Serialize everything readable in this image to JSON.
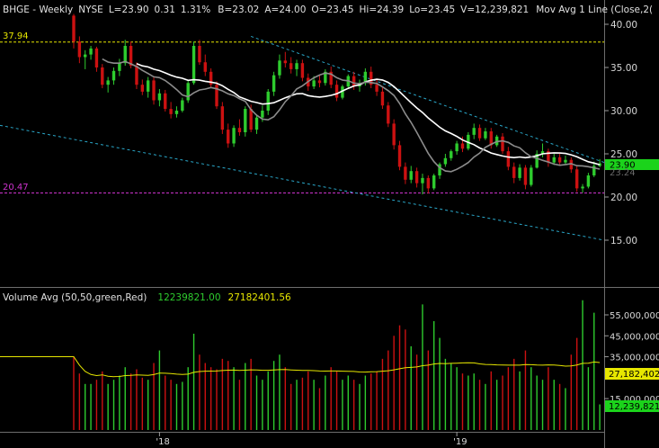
{
  "header": {
    "symbol": "BHGE - Weekly",
    "exchange": "NYSE",
    "last": "L=23.90",
    "change": "0.31",
    "change_pct": "1.31%",
    "bid": "B=23.02",
    "ask": "A=24.00",
    "open": "O=23.45",
    "high": "Hi=24.39",
    "low": "Lo=23.45",
    "volume": "V=12,239,821",
    "indicator": "Mov Avg 1 Line (Close,2("
  },
  "volume_header": {
    "label": "Volume Avg (50,50,green,Red)",
    "value1": "12239821.00",
    "value2": "27182401.56"
  },
  "price_axis": {
    "ticks": [
      {
        "value": 40,
        "label": "40.00"
      },
      {
        "value": 35,
        "label": "35.00"
      },
      {
        "value": 30,
        "label": "30.00"
      },
      {
        "value": 25,
        "label": "25.00"
      },
      {
        "value": 20,
        "label": "20.00"
      },
      {
        "value": 15,
        "label": "15.00"
      }
    ],
    "last_price_label": "23.90",
    "hidden_label": "23.24"
  },
  "volume_axis": {
    "ticks": [
      {
        "value": 55000000,
        "label": "55,000,000"
      },
      {
        "value": 45000000,
        "label": "45,000,000"
      },
      {
        "value": 35000000,
        "label": "35,000,000"
      },
      {
        "value": 15000000,
        "label": "15,000,000"
      }
    ],
    "avg_label": "27,182,402",
    "last_label": "12,239,821"
  },
  "levels": {
    "upper": {
      "value": 37.94,
      "label": "37.94"
    },
    "lower": {
      "value": 20.47,
      "label": "20.47"
    }
  },
  "x_axis": {
    "labels": [
      {
        "week": 15,
        "label": "'18"
      },
      {
        "week": 67,
        "label": "'19"
      }
    ]
  },
  "colors": {
    "up": "#2ecc2e",
    "down": "#cc1111",
    "upper_level": "#e6e600",
    "lower_level": "#cc33cc",
    "channel": "#2aa7c9",
    "ma_white": "#ffffff",
    "ma_gray": "#8c8c8c",
    "vol_avg": "#e6e600"
  },
  "chart_data": {
    "type": "candlestick",
    "title": "BHGE - Weekly",
    "price_range": [
      13,
      42
    ],
    "volume_range": [
      0,
      62000000
    ],
    "candles": [
      [
        41.0,
        41.2,
        37.2,
        38.0,
        35000000
      ],
      [
        38.0,
        38.6,
        35.5,
        36.2,
        27000000
      ],
      [
        36.2,
        37.0,
        34.8,
        36.5,
        22000000
      ],
      [
        36.5,
        37.5,
        35.9,
        37.2,
        22000000
      ],
      [
        37.2,
        37.4,
        34.5,
        35.0,
        24000000
      ],
      [
        35.0,
        35.4,
        32.6,
        33.0,
        28000000
      ],
      [
        33.0,
        33.9,
        32.1,
        33.5,
        22000000
      ],
      [
        33.5,
        35.0,
        33.0,
        34.6,
        24000000
      ],
      [
        34.6,
        36.0,
        34.0,
        35.5,
        26000000
      ],
      [
        35.5,
        38.2,
        35.2,
        37.5,
        30000000
      ],
      [
        37.5,
        38.0,
        34.9,
        35.2,
        27000000
      ],
      [
        35.2,
        35.6,
        32.5,
        33.0,
        29000000
      ],
      [
        33.0,
        33.6,
        31.8,
        32.2,
        25000000
      ],
      [
        32.2,
        33.9,
        31.5,
        33.5,
        24000000
      ],
      [
        33.5,
        34.0,
        30.7,
        31.2,
        32000000
      ],
      [
        31.2,
        32.5,
        30.5,
        32.0,
        38000000
      ],
      [
        32.0,
        32.4,
        29.9,
        30.2,
        26000000
      ],
      [
        30.2,
        31.0,
        29.1,
        29.6,
        24000000
      ],
      [
        29.6,
        30.5,
        29.2,
        30.0,
        22000000
      ],
      [
        30.0,
        31.5,
        29.8,
        31.2,
        23000000
      ],
      [
        31.2,
        33.5,
        30.9,
        33.2,
        30000000
      ],
      [
        33.2,
        38.0,
        33.0,
        37.5,
        46000000
      ],
      [
        37.5,
        38.2,
        35.3,
        35.6,
        36000000
      ],
      [
        35.6,
        36.5,
        34.0,
        34.5,
        32000000
      ],
      [
        34.5,
        34.9,
        32.7,
        33.0,
        30000000
      ],
      [
        33.0,
        33.4,
        30.2,
        30.5,
        29000000
      ],
      [
        30.5,
        31.0,
        27.3,
        27.8,
        34000000
      ],
      [
        27.8,
        28.5,
        25.7,
        26.2,
        33000000
      ],
      [
        26.2,
        28.3,
        25.8,
        28.0,
        30000000
      ],
      [
        28.0,
        29.0,
        27.1,
        27.5,
        24000000
      ],
      [
        27.5,
        30.5,
        27.0,
        30.2,
        32000000
      ],
      [
        30.2,
        30.7,
        27.5,
        27.8,
        34000000
      ],
      [
        27.8,
        29.5,
        27.3,
        29.2,
        26000000
      ],
      [
        29.2,
        30.6,
        28.7,
        30.0,
        24000000
      ],
      [
        30.0,
        32.5,
        29.5,
        32.2,
        28000000
      ],
      [
        32.2,
        34.5,
        31.7,
        34.1,
        33000000
      ],
      [
        34.1,
        36.5,
        33.7,
        35.8,
        36000000
      ],
      [
        35.8,
        36.8,
        35.0,
        35.5,
        30000000
      ],
      [
        35.5,
        36.2,
        34.3,
        34.8,
        22000000
      ],
      [
        34.8,
        35.9,
        34.0,
        35.5,
        24000000
      ],
      [
        35.5,
        35.9,
        33.4,
        33.8,
        25000000
      ],
      [
        33.8,
        34.3,
        32.3,
        32.8,
        28000000
      ],
      [
        32.8,
        34.0,
        32.5,
        33.5,
        24000000
      ],
      [
        33.5,
        34.2,
        32.7,
        33.2,
        20000000
      ],
      [
        33.2,
        34.8,
        32.9,
        34.5,
        26000000
      ],
      [
        34.5,
        35.1,
        32.6,
        33.0,
        30000000
      ],
      [
        33.0,
        33.5,
        31.1,
        31.5,
        28000000
      ],
      [
        31.5,
        33.0,
        31.3,
        32.8,
        24000000
      ],
      [
        32.8,
        34.2,
        32.6,
        34.0,
        26000000
      ],
      [
        34.0,
        34.5,
        32.4,
        32.8,
        24000000
      ],
      [
        32.8,
        33.6,
        32.2,
        33.2,
        22000000
      ],
      [
        33.2,
        34.9,
        32.9,
        34.5,
        26000000
      ],
      [
        34.5,
        35.1,
        32.6,
        33.0,
        27000000
      ],
      [
        33.0,
        33.7,
        31.7,
        32.2,
        28000000
      ],
      [
        32.2,
        32.7,
        30.2,
        30.6,
        34000000
      ],
      [
        30.6,
        31.0,
        28.1,
        28.5,
        38000000
      ],
      [
        28.5,
        29.0,
        25.5,
        26.0,
        45000000
      ],
      [
        26.0,
        26.5,
        23.1,
        23.5,
        50000000
      ],
      [
        23.5,
        24.0,
        21.5,
        22.0,
        48000000
      ],
      [
        22.0,
        23.6,
        21.6,
        23.0,
        40000000
      ],
      [
        23.0,
        23.4,
        21.1,
        21.6,
        36000000
      ],
      [
        21.6,
        22.7,
        20.3,
        22.2,
        60000000
      ],
      [
        22.2,
        22.5,
        20.4,
        21.0,
        38000000
      ],
      [
        21.0,
        22.7,
        20.8,
        22.5,
        52000000
      ],
      [
        22.5,
        24.0,
        22.1,
        23.8,
        44000000
      ],
      [
        23.8,
        25.0,
        23.5,
        24.5,
        34000000
      ],
      [
        24.5,
        25.5,
        24.2,
        25.3,
        32000000
      ],
      [
        25.3,
        26.5,
        24.9,
        26.2,
        30000000
      ],
      [
        26.2,
        27.0,
        25.2,
        25.6,
        27000000
      ],
      [
        25.6,
        27.5,
        25.4,
        27.2,
        26000000
      ],
      [
        27.2,
        28.5,
        26.7,
        28.0,
        27000000
      ],
      [
        28.0,
        28.4,
        26.5,
        26.8,
        24000000
      ],
      [
        26.8,
        28.0,
        26.6,
        27.6,
        22000000
      ],
      [
        27.6,
        28.0,
        25.6,
        26.0,
        28000000
      ],
      [
        26.0,
        27.2,
        25.8,
        27.0,
        24000000
      ],
      [
        27.0,
        27.4,
        25.0,
        25.3,
        26000000
      ],
      [
        25.3,
        25.8,
        23.1,
        23.5,
        30000000
      ],
      [
        23.5,
        24.0,
        21.6,
        22.2,
        34000000
      ],
      [
        22.2,
        23.8,
        21.9,
        23.4,
        28000000
      ],
      [
        23.4,
        23.7,
        20.9,
        21.4,
        38000000
      ],
      [
        21.4,
        23.7,
        21.2,
        23.4,
        30000000
      ],
      [
        23.4,
        25.4,
        23.3,
        25.0,
        26000000
      ],
      [
        25.0,
        26.2,
        24.6,
        25.3,
        24000000
      ],
      [
        25.3,
        25.6,
        23.5,
        24.0,
        30000000
      ],
      [
        24.0,
        25.0,
        23.7,
        24.6,
        24000000
      ],
      [
        24.6,
        25.0,
        23.6,
        24.0,
        22000000
      ],
      [
        24.0,
        24.8,
        23.7,
        24.3,
        20000000
      ],
      [
        24.3,
        24.6,
        22.8,
        23.2,
        36000000
      ],
      [
        23.2,
        23.6,
        20.6,
        21.0,
        44000000
      ],
      [
        21.0,
        21.5,
        20.5,
        21.2,
        62000000
      ],
      [
        21.2,
        22.8,
        21.0,
        22.5,
        30000000
      ],
      [
        22.5,
        24.1,
        22.3,
        23.6,
        56000000
      ],
      [
        23.59,
        24.39,
        23.45,
        23.9,
        12239821
      ]
    ]
  }
}
